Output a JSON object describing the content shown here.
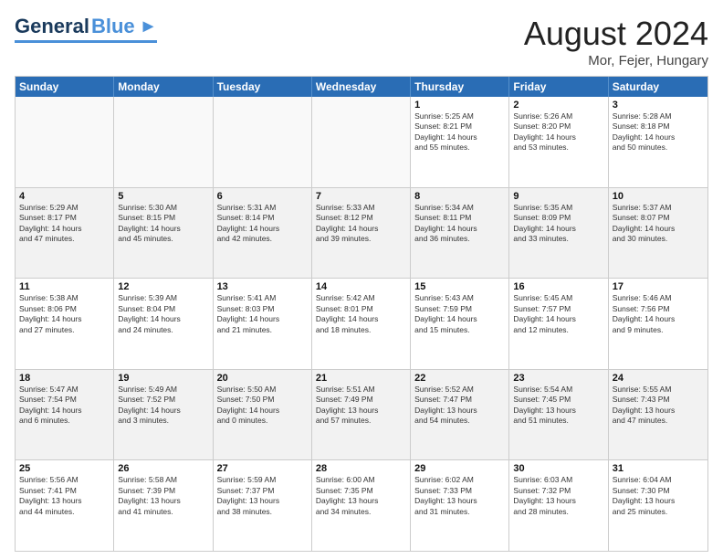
{
  "header": {
    "logo_general": "General",
    "logo_blue": "Blue",
    "month_title": "August 2024",
    "location": "Mor, Fejer, Hungary"
  },
  "weekdays": [
    "Sunday",
    "Monday",
    "Tuesday",
    "Wednesday",
    "Thursday",
    "Friday",
    "Saturday"
  ],
  "rows": [
    [
      {
        "day": "",
        "info": "",
        "empty": true
      },
      {
        "day": "",
        "info": "",
        "empty": true
      },
      {
        "day": "",
        "info": "",
        "empty": true
      },
      {
        "day": "",
        "info": "",
        "empty": true
      },
      {
        "day": "1",
        "info": "Sunrise: 5:25 AM\nSunset: 8:21 PM\nDaylight: 14 hours\nand 55 minutes."
      },
      {
        "day": "2",
        "info": "Sunrise: 5:26 AM\nSunset: 8:20 PM\nDaylight: 14 hours\nand 53 minutes."
      },
      {
        "day": "3",
        "info": "Sunrise: 5:28 AM\nSunset: 8:18 PM\nDaylight: 14 hours\nand 50 minutes."
      }
    ],
    [
      {
        "day": "4",
        "info": "Sunrise: 5:29 AM\nSunset: 8:17 PM\nDaylight: 14 hours\nand 47 minutes."
      },
      {
        "day": "5",
        "info": "Sunrise: 5:30 AM\nSunset: 8:15 PM\nDaylight: 14 hours\nand 45 minutes."
      },
      {
        "day": "6",
        "info": "Sunrise: 5:31 AM\nSunset: 8:14 PM\nDaylight: 14 hours\nand 42 minutes."
      },
      {
        "day": "7",
        "info": "Sunrise: 5:33 AM\nSunset: 8:12 PM\nDaylight: 14 hours\nand 39 minutes."
      },
      {
        "day": "8",
        "info": "Sunrise: 5:34 AM\nSunset: 8:11 PM\nDaylight: 14 hours\nand 36 minutes."
      },
      {
        "day": "9",
        "info": "Sunrise: 5:35 AM\nSunset: 8:09 PM\nDaylight: 14 hours\nand 33 minutes."
      },
      {
        "day": "10",
        "info": "Sunrise: 5:37 AM\nSunset: 8:07 PM\nDaylight: 14 hours\nand 30 minutes."
      }
    ],
    [
      {
        "day": "11",
        "info": "Sunrise: 5:38 AM\nSunset: 8:06 PM\nDaylight: 14 hours\nand 27 minutes."
      },
      {
        "day": "12",
        "info": "Sunrise: 5:39 AM\nSunset: 8:04 PM\nDaylight: 14 hours\nand 24 minutes."
      },
      {
        "day": "13",
        "info": "Sunrise: 5:41 AM\nSunset: 8:03 PM\nDaylight: 14 hours\nand 21 minutes."
      },
      {
        "day": "14",
        "info": "Sunrise: 5:42 AM\nSunset: 8:01 PM\nDaylight: 14 hours\nand 18 minutes."
      },
      {
        "day": "15",
        "info": "Sunrise: 5:43 AM\nSunset: 7:59 PM\nDaylight: 14 hours\nand 15 minutes."
      },
      {
        "day": "16",
        "info": "Sunrise: 5:45 AM\nSunset: 7:57 PM\nDaylight: 14 hours\nand 12 minutes."
      },
      {
        "day": "17",
        "info": "Sunrise: 5:46 AM\nSunset: 7:56 PM\nDaylight: 14 hours\nand 9 minutes."
      }
    ],
    [
      {
        "day": "18",
        "info": "Sunrise: 5:47 AM\nSunset: 7:54 PM\nDaylight: 14 hours\nand 6 minutes."
      },
      {
        "day": "19",
        "info": "Sunrise: 5:49 AM\nSunset: 7:52 PM\nDaylight: 14 hours\nand 3 minutes."
      },
      {
        "day": "20",
        "info": "Sunrise: 5:50 AM\nSunset: 7:50 PM\nDaylight: 14 hours\nand 0 minutes."
      },
      {
        "day": "21",
        "info": "Sunrise: 5:51 AM\nSunset: 7:49 PM\nDaylight: 13 hours\nand 57 minutes."
      },
      {
        "day": "22",
        "info": "Sunrise: 5:52 AM\nSunset: 7:47 PM\nDaylight: 13 hours\nand 54 minutes."
      },
      {
        "day": "23",
        "info": "Sunrise: 5:54 AM\nSunset: 7:45 PM\nDaylight: 13 hours\nand 51 minutes."
      },
      {
        "day": "24",
        "info": "Sunrise: 5:55 AM\nSunset: 7:43 PM\nDaylight: 13 hours\nand 47 minutes."
      }
    ],
    [
      {
        "day": "25",
        "info": "Sunrise: 5:56 AM\nSunset: 7:41 PM\nDaylight: 13 hours\nand 44 minutes."
      },
      {
        "day": "26",
        "info": "Sunrise: 5:58 AM\nSunset: 7:39 PM\nDaylight: 13 hours\nand 41 minutes."
      },
      {
        "day": "27",
        "info": "Sunrise: 5:59 AM\nSunset: 7:37 PM\nDaylight: 13 hours\nand 38 minutes."
      },
      {
        "day": "28",
        "info": "Sunrise: 6:00 AM\nSunset: 7:35 PM\nDaylight: 13 hours\nand 34 minutes."
      },
      {
        "day": "29",
        "info": "Sunrise: 6:02 AM\nSunset: 7:33 PM\nDaylight: 13 hours\nand 31 minutes."
      },
      {
        "day": "30",
        "info": "Sunrise: 6:03 AM\nSunset: 7:32 PM\nDaylight: 13 hours\nand 28 minutes."
      },
      {
        "day": "31",
        "info": "Sunrise: 6:04 AM\nSunset: 7:30 PM\nDaylight: 13 hours\nand 25 minutes."
      }
    ]
  ]
}
